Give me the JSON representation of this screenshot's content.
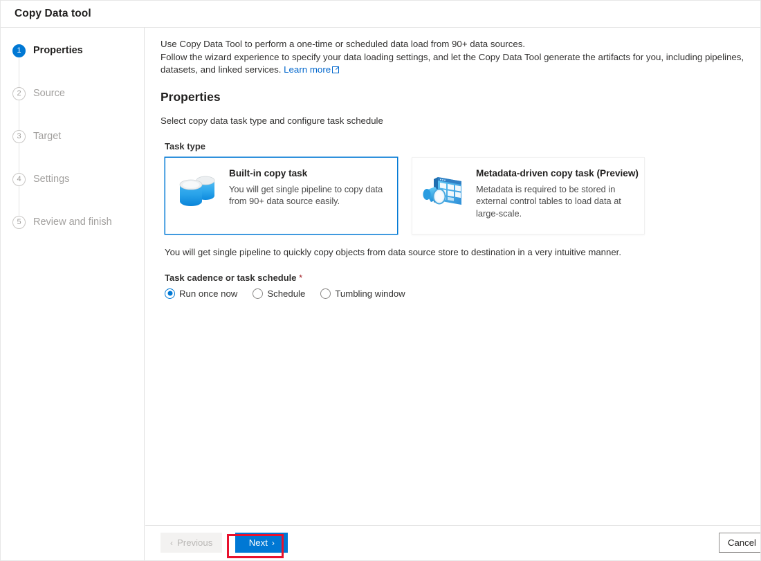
{
  "window": {
    "title": "Copy Data tool"
  },
  "sidebar": {
    "steps": [
      {
        "number": "1",
        "label": "Properties",
        "state": "active"
      },
      {
        "number": "2",
        "label": "Source",
        "state": "inactive"
      },
      {
        "number": "3",
        "label": "Target",
        "state": "inactive"
      },
      {
        "number": "4",
        "label": "Settings",
        "state": "inactive"
      },
      {
        "number": "5",
        "label": "Review and finish",
        "state": "inactive"
      }
    ]
  },
  "main": {
    "intro_line1": "Use Copy Data Tool to perform a one-time or scheduled data load from 90+ data sources.",
    "intro_line2": "Follow the wizard experience to specify your data loading settings, and let the Copy Data Tool generate the artifacts for you, including pipelines, datasets, and linked services.",
    "learn_more_label": "Learn more",
    "section_title": "Properties",
    "section_subtitle": "Select copy data task type and configure task schedule",
    "task_type_label": "Task type",
    "cards": [
      {
        "title": "Built-in copy task",
        "description": "You will get single pipeline to copy data from 90+ data source easily.",
        "icon": "database-cylinders-icon",
        "selected": true
      },
      {
        "title": "Metadata-driven copy task (Preview)",
        "description": "Metadata is required to be stored in external control tables to load data at large-scale.",
        "icon": "metadata-table-search-icon",
        "selected": false
      }
    ],
    "note": "You will get single pipeline to quickly copy objects from data source store to destination in a very intuitive manner.",
    "cadence_label": "Task cadence or task schedule",
    "cadence_required_mark": "*",
    "cadence_options": [
      {
        "label": "Run once now",
        "selected": true
      },
      {
        "label": "Schedule",
        "selected": false
      },
      {
        "label": "Tumbling window",
        "selected": false
      }
    ]
  },
  "footer": {
    "previous_label": "Previous",
    "next_label": "Next",
    "cancel_label": "Cancel",
    "previous_chevron": "‹",
    "next_chevron": "›"
  },
  "colors": {
    "accent": "#0078d4",
    "highlight": "#e8112d",
    "muted": "#a19f9d",
    "link": "#0066cc"
  }
}
